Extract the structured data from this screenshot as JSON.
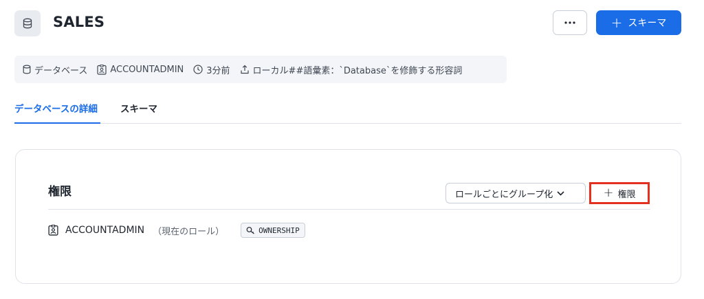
{
  "header": {
    "title": "SALES",
    "more_label": "···",
    "create_schema_label": "スキーマ"
  },
  "meta": {
    "type_label": "データベース",
    "owner_role": "ACCOUNTADMIN",
    "created": "3分前",
    "comment": "ローカル##語彙素：`Database`を修飾する形容詞"
  },
  "tabs": [
    {
      "label": "データベースの詳細",
      "active": true
    },
    {
      "label": "スキーマ",
      "active": false
    }
  ],
  "permissions": {
    "title": "権限",
    "group_by_label": "ロールごとにグループ化",
    "add_label": "権限",
    "rows": [
      {
        "role": "ACCOUNTADMIN",
        "note": "（現在のロール）",
        "privilege": "OWNERSHIP"
      }
    ]
  },
  "colors": {
    "accent": "#1a6ce7",
    "highlight": "#e4301f",
    "text": "#1e252f"
  }
}
